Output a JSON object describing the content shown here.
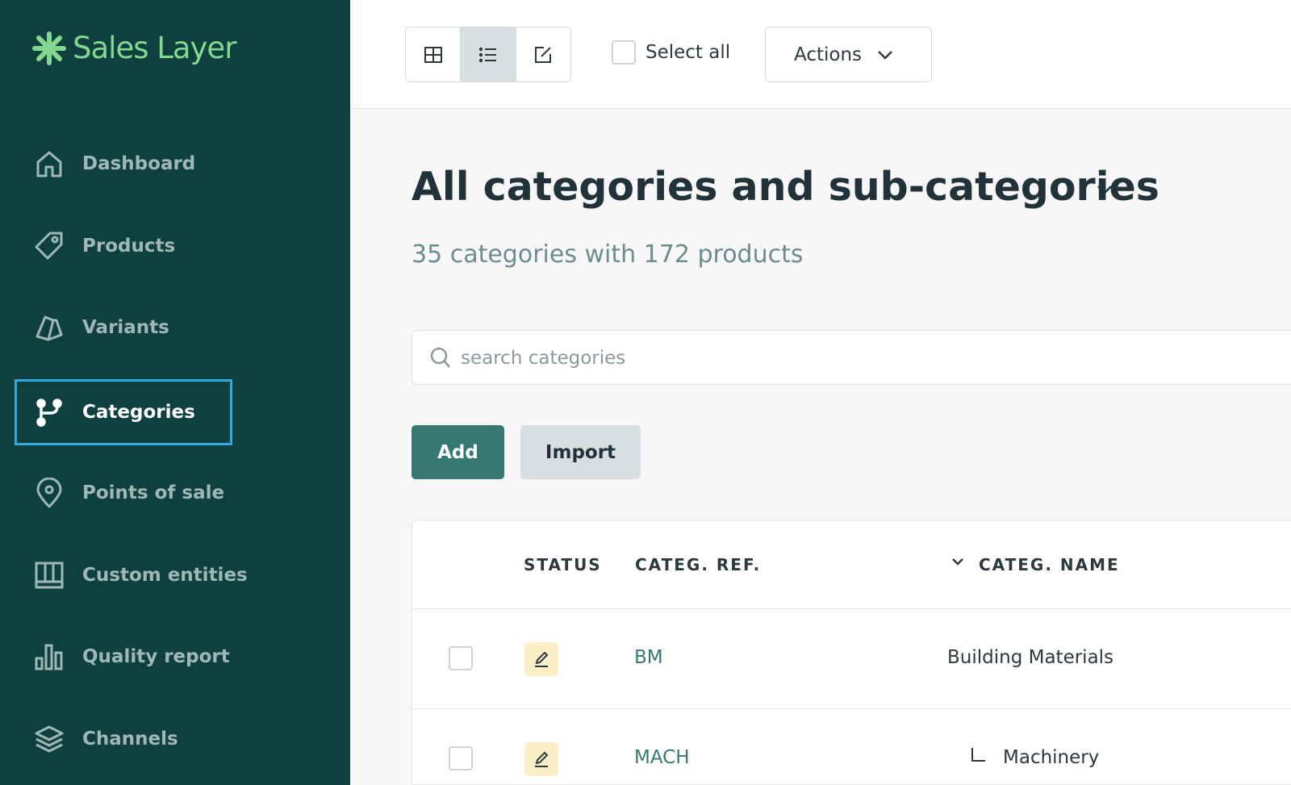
{
  "app": {
    "logo_text": "Sales Layer",
    "brand_color": "#83d88f",
    "accent_color": "#357972"
  },
  "sidebar": {
    "items": [
      {
        "label": "Dashboard",
        "icon": "home-icon",
        "active": false
      },
      {
        "label": "Products",
        "icon": "tag-icon",
        "active": false
      },
      {
        "label": "Variants",
        "icon": "variants-icon",
        "active": false
      },
      {
        "label": "Categories",
        "icon": "branch-icon",
        "active": true
      },
      {
        "label": "Points of sale",
        "icon": "map-pin-icon",
        "active": false
      },
      {
        "label": "Custom entities",
        "icon": "custom-entities-icon",
        "active": false
      },
      {
        "label": "Quality report",
        "icon": "bar-chart-icon",
        "active": false
      },
      {
        "label": "Channels",
        "icon": "layers-icon",
        "active": false
      }
    ]
  },
  "toolbar": {
    "view_modes": [
      "grid-view-icon",
      "list-view-icon",
      "edit-view-icon"
    ],
    "active_view": "list-view-icon",
    "select_all_label": "Select all",
    "actions_label": "Actions"
  },
  "main": {
    "title": "All categories and sub-categories",
    "subtitle": "35 categories with 172 products",
    "search_placeholder": "search categories",
    "add_label": "Add",
    "import_label": "Import"
  },
  "table": {
    "headers": {
      "status": "STATUS",
      "ref": "CATEG. REF.",
      "name": "CATEG. NAME"
    },
    "rows": [
      {
        "status_icon": "edit-icon",
        "ref": "BM",
        "name": "Building Materials",
        "level": 0
      },
      {
        "status_icon": "edit-icon",
        "ref": "MACH",
        "name": "Machinery",
        "level": 1
      }
    ]
  }
}
